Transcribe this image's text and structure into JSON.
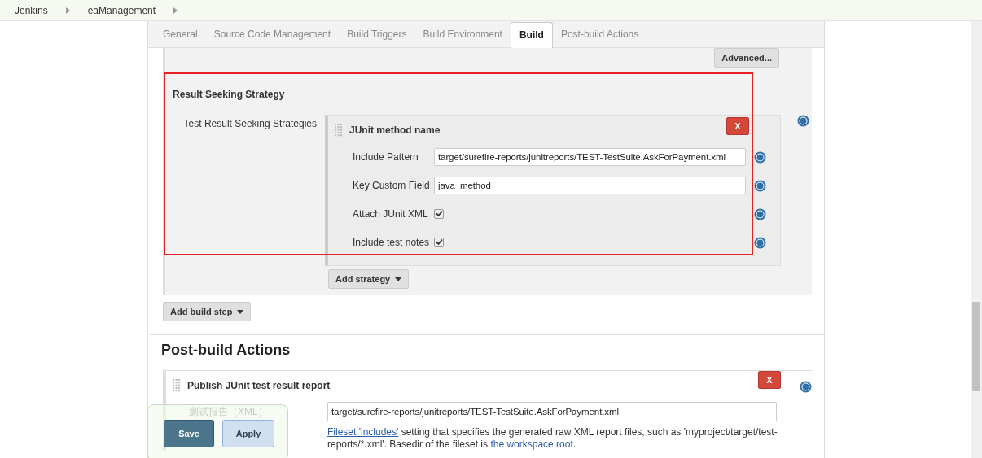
{
  "breadcrumbs": [
    "Jenkins",
    "eaManagement"
  ],
  "tabs": [
    {
      "label": "General",
      "selected": false
    },
    {
      "label": "Source Code Management",
      "selected": false
    },
    {
      "label": "Build Triggers",
      "selected": false
    },
    {
      "label": "Build Environment",
      "selected": false
    },
    {
      "label": "Build",
      "selected": true
    },
    {
      "label": "Post-build Actions",
      "selected": false
    }
  ],
  "advanced_button": "Advanced...",
  "result_section": {
    "title": "Result Seeking Strategy",
    "label": "Test Result Seeking Strategies",
    "strategy_title": "JUnit method name",
    "delete": "X",
    "fields": [
      {
        "kind": "text",
        "label": "Include Pattern",
        "value": "target/surefire-reports/junitreports/TEST-TestSuite.AskForPayment.xml"
      },
      {
        "kind": "text",
        "label": "Key Custom Field",
        "value": "java_method"
      },
      {
        "kind": "checkbox",
        "label": "Attach JUnit XML",
        "checked": true
      },
      {
        "kind": "checkbox",
        "label": "Include test notes",
        "checked": true
      }
    ],
    "add_strategy": "Add strategy"
  },
  "add_build_step": "Add build step",
  "post_build": {
    "heading": "Post-build Actions",
    "title": "Publish JUnit test result report",
    "delete": "X",
    "label": "测试报告（XML）",
    "value": "target/surefire-reports/junitreports/TEST-TestSuite.AskForPayment.xml",
    "help_link": "Fileset 'includes'",
    "help_text": " setting that specifies the generated raw XML report files, such as 'myproject/target/test-reports/*.xml'. Basedir of the fileset is ",
    "help_link2": "the workspace root",
    "help_end": "."
  },
  "buttons": {
    "save": "Save",
    "apply": "Apply"
  }
}
